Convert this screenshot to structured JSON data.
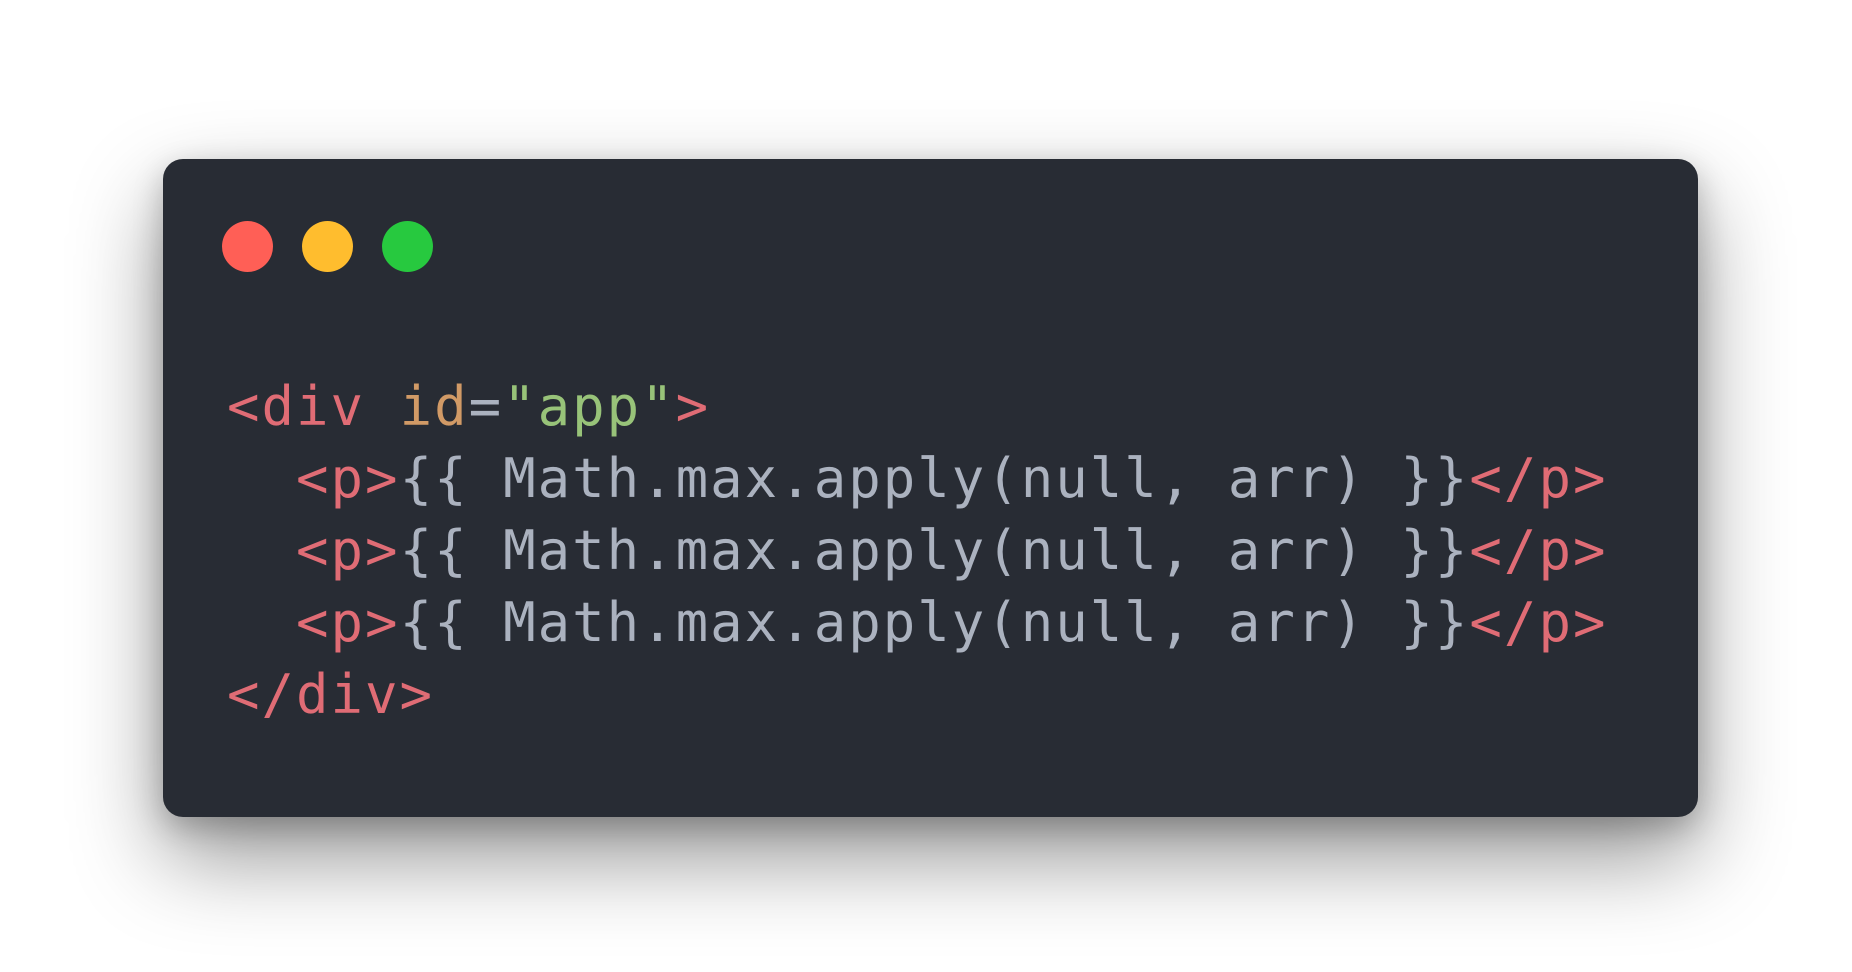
{
  "colors": {
    "background": "#ffffff",
    "window": "#282c34",
    "close": "#ff5f56",
    "minimize": "#ffbd2e",
    "zoom": "#27c93f",
    "tag": "#e06c75",
    "attribute": "#d19a66",
    "string": "#98c379",
    "text": "#abb2bf"
  },
  "window_controls": [
    "close",
    "minimize",
    "zoom"
  ],
  "code": {
    "line1": {
      "open": "<div",
      "space": " ",
      "attr": "id",
      "eq": "=",
      "value": "\"app\"",
      "close": ">"
    },
    "line2": {
      "indent": "  ",
      "open_tag": "<p>",
      "expr": "{{ Math.max.apply(null, arr) }}",
      "close_tag": "</p>"
    },
    "line3": {
      "indent": "  ",
      "open_tag": "<p>",
      "expr": "{{ Math.max.apply(null, arr) }}",
      "close_tag": "</p>"
    },
    "line4": {
      "indent": "  ",
      "open_tag": "<p>",
      "expr": "{{ Math.max.apply(null, arr) }}",
      "close_tag": "</p>"
    },
    "line5": {
      "close_tag": "</div>"
    }
  }
}
